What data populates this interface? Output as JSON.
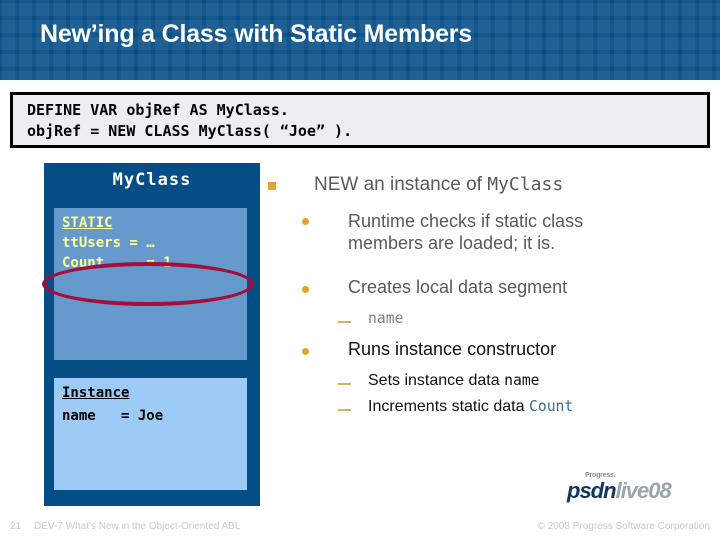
{
  "slide": {
    "title": "New’ing a Class with Static Members",
    "accent_header": "#054d85",
    "accent_bullet": "#e0a52e",
    "accent_ellipse": "#a50d3c"
  },
  "code_block": {
    "line1": "DEFINE VAR objRef AS MyClass.",
    "line2": "objRef = NEW CLASS MyClass( “Joe” )."
  },
  "class_diagram": {
    "title": "MyClass",
    "static_panel": {
      "heading": "STATIC",
      "line1": "ttUsers = …",
      "line2": "Count     = 1"
    },
    "instance_panel": {
      "heading": "Instance",
      "line1": "name   = Joe"
    }
  },
  "content": {
    "level1": {
      "text_before": "NEW an instance of ",
      "code": "MyClass"
    },
    "bullets": [
      {
        "text": "Runtime checks if static class members are loaded; it is."
      },
      {
        "text": "Creates local data segment",
        "subs": [
          {
            "code": "name"
          }
        ]
      },
      {
        "text": "Runs instance constructor",
        "subs": [
          {
            "text_before": "Sets instance data ",
            "code": "name"
          },
          {
            "text_before": "Increments static data ",
            "code": "Count"
          }
        ]
      }
    ]
  },
  "logo": {
    "progress": "Progress.",
    "psdn": "psdn",
    "live": "live08"
  },
  "footer": {
    "page_number": "21",
    "title": "DEV-7 What's New in the Object-Oriented ABL",
    "copyright": "© 2008 Progress Software Corporation"
  }
}
